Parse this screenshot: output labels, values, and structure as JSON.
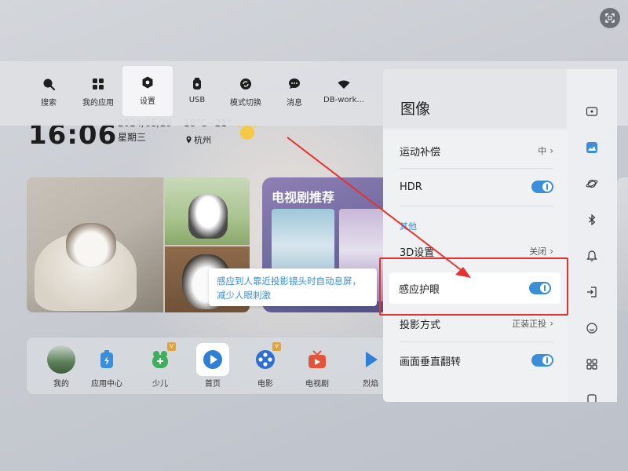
{
  "topbar": {
    "items": [
      {
        "label": "搜索",
        "icon": "search-icon"
      },
      {
        "label": "我的应用",
        "icon": "grid-icon"
      },
      {
        "label": "设置",
        "icon": "gear-icon",
        "active": true
      },
      {
        "label": "USB",
        "icon": "usb-icon"
      },
      {
        "label": "模式切换",
        "icon": "mode-switch-icon"
      },
      {
        "label": "消息",
        "icon": "message-icon"
      },
      {
        "label": "DB-work...",
        "icon": "wifi-icon"
      }
    ]
  },
  "home": {
    "clock": "16:06",
    "date": "2024/05/29",
    "weekday": "星期三",
    "weather_range": "18°C~21°",
    "city": "杭州",
    "tv_card_title": "电视剧推荐"
  },
  "tooltip": {
    "text": "感应到人靠近投影镜头时自动息屏，减少人眼刺激"
  },
  "dock": {
    "apps": [
      {
        "label": "我的",
        "icon": "avatar-icon"
      },
      {
        "label": "应用中心",
        "icon": "app-center-icon"
      },
      {
        "label": "少儿",
        "icon": "kids-icon",
        "badge": "V"
      },
      {
        "label": "首页",
        "icon": "home-play-icon",
        "focused": true
      },
      {
        "label": "电影",
        "icon": "film-reel-icon",
        "badge": "V"
      },
      {
        "label": "电视剧",
        "icon": "tv-icon"
      },
      {
        "label": "烈焰",
        "icon": "play-icon"
      }
    ]
  },
  "panel": {
    "title": "图像",
    "rows": {
      "motion": {
        "label": "运动补偿",
        "value": "中"
      },
      "hdr": {
        "label": "HDR",
        "on": true
      },
      "section_other": "其他",
      "three_d": {
        "label": "3D设置",
        "value": "关闭"
      },
      "eye_care": {
        "label": "感应护眼",
        "on": true
      },
      "projection": {
        "label": "投影方式",
        "value": "正装正投"
      },
      "flip": {
        "label": "画面垂直翻转",
        "on": true
      }
    },
    "side_icons": [
      "picture-mode-icon",
      "image-icon",
      "planet-icon",
      "bluetooth-icon",
      "bell-icon",
      "input-source-icon",
      "smile-icon",
      "apps-grid-icon",
      "more-icon"
    ]
  },
  "colors": {
    "accent": "#3a8fd8",
    "annotation": "#e5322e"
  }
}
